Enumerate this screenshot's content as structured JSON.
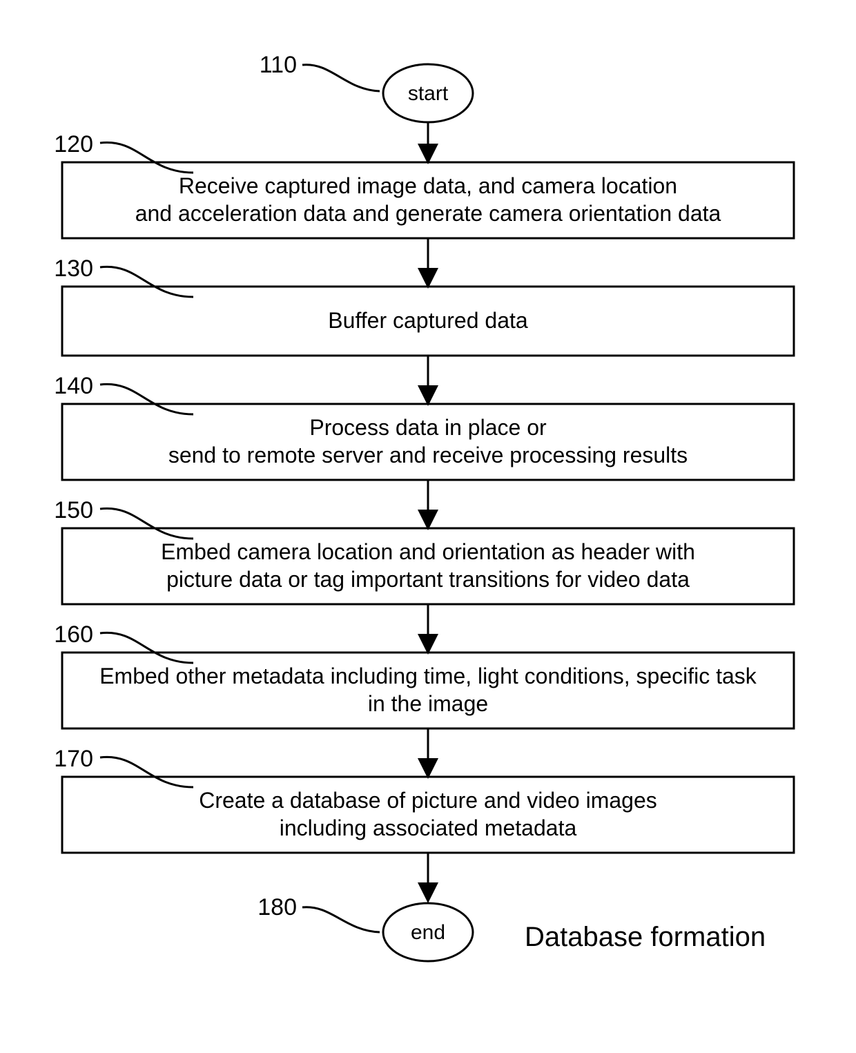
{
  "labels": {
    "n110": "110",
    "n120": "120",
    "n130": "130",
    "n140": "140",
    "n150": "150",
    "n160": "160",
    "n170": "170",
    "n180": "180"
  },
  "start": "start",
  "end": "end",
  "caption": "Database formation",
  "steps": {
    "s120a": "Receive captured image data, and camera location",
    "s120b": "and acceleration data and generate camera orientation data",
    "s130": "Buffer captured data",
    "s140a": "Process data in place or",
    "s140b": "send to remote server and receive processing results",
    "s150a": "Embed camera location and orientation as header with",
    "s150b": "picture data or tag important transitions for video data",
    "s160a": "Embed other metadata including time, light conditions, specific task",
    "s160b": "in the image",
    "s170a": "Create a database of picture and video images",
    "s170b": "including associated metadata"
  }
}
